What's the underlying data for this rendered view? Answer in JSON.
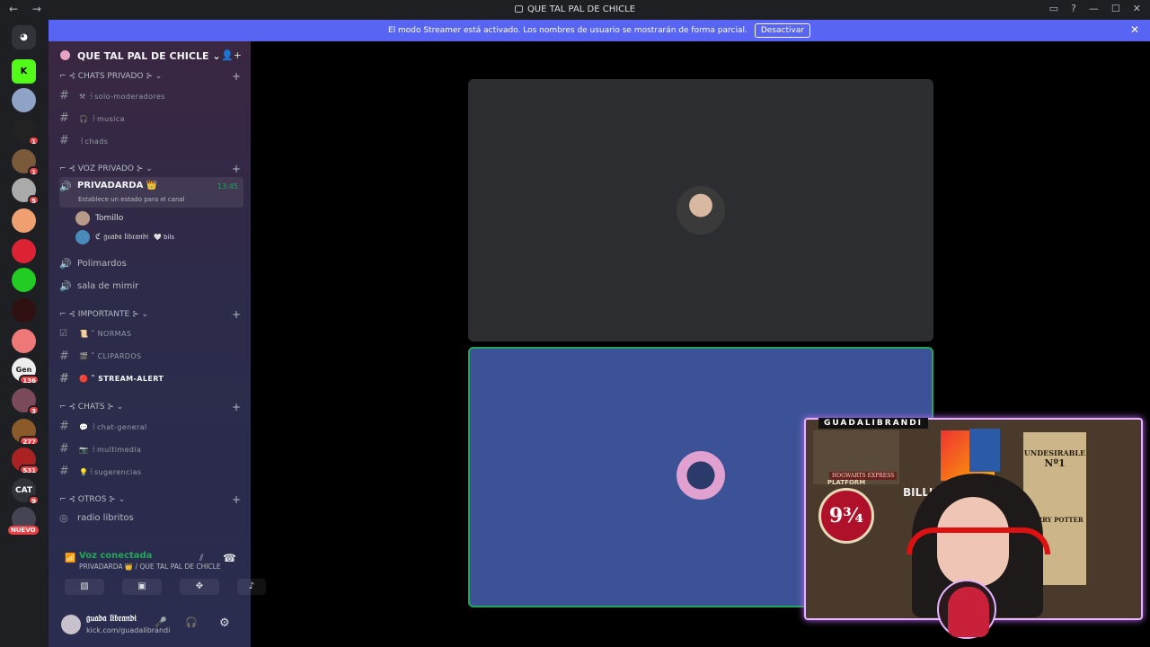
{
  "titlebar": {
    "title": "QUE TAL PAL DE CHICLE",
    "nav": "← →",
    "icons": [
      "inbox-icon",
      "help-icon",
      "minimize-icon",
      "maximize-icon",
      "close-icon"
    ]
  },
  "banner": {
    "text": "El modo Streamer está activado. Los nombres de usuario se mostrarán de forma parcial.",
    "button": "Desactivar"
  },
  "rail": {
    "badges": [
      "1",
      "1",
      "5",
      "136",
      "3",
      "277",
      "531",
      "9"
    ],
    "cat_label": "CAT",
    "gen_label": "Gen",
    "nuevo": "NUEVO"
  },
  "server": {
    "name": "QUE TAL PAL DE CHICLE"
  },
  "categories": {
    "chats_privado": "⊰ CHATS PRIVADO ⊱",
    "voz_privado": "⊰ VOZ PRIVADO ⊱",
    "importante": "⊰ IMPORTANTE ⊱",
    "chats": "⊰ CHATS ⊱",
    "otros": "⊰ OTROS ⊱"
  },
  "channels": {
    "solo_mod": "⚒ ꒱solo-moderadores",
    "musica": "🎧 ꒱musica",
    "chads": "꒱chads",
    "normas": "📜 ˚ NORMAS",
    "clipardos": "🎬 ˚ CLIPARDOS",
    "stream_alert": "🔴 ˚ STREAM-ALERT",
    "chat_general": "💬 ꒱chat-general",
    "multimedia": "📷 ꒱multimedia",
    "sugerencias": "💡꒱sugerencias"
  },
  "voice": {
    "privadarda": "PRIVADARDA 👑",
    "privadarda_time": "13:45",
    "privadarda_status": "Establece un estado para el canal",
    "user1": "Tomillo",
    "user2": "ℭ 𝔤𝔲𝔞𝔡𝔞 𝔩𝔦𝔟𝔯𝔞𝔫𝔡𝔦",
    "user2_tag": "🤍 bils",
    "polimardos": "Polimardos",
    "sala": "sala de mimir",
    "radio": "radio libritos"
  },
  "voicebar": {
    "status": "Voz conectada",
    "location": "PRIVADARDA 👑 / QUE TAL PAL DE CHICLE"
  },
  "userpanel": {
    "name": "𝔤𝔲𝔞𝔡𝔞 𝔩𝔦𝔟𝔯𝔞𝔫𝔡𝔦",
    "status": "kick.com/guadalibrandi"
  },
  "webcam": {
    "title": "GUADALIBRANDI",
    "platform": "9¾",
    "platform_label": "PLATFORM",
    "hogwarts": "HOGWARTS EXPRESS",
    "billie": "BILLIE",
    "wanted_a": "UNDESIRABLE",
    "wanted_b": "Nº1",
    "wanted_c": "HARRY POTTER"
  },
  "colors": {
    "accent": "#5865f2",
    "connected": "#23a55a",
    "badge": "#f23f43"
  }
}
